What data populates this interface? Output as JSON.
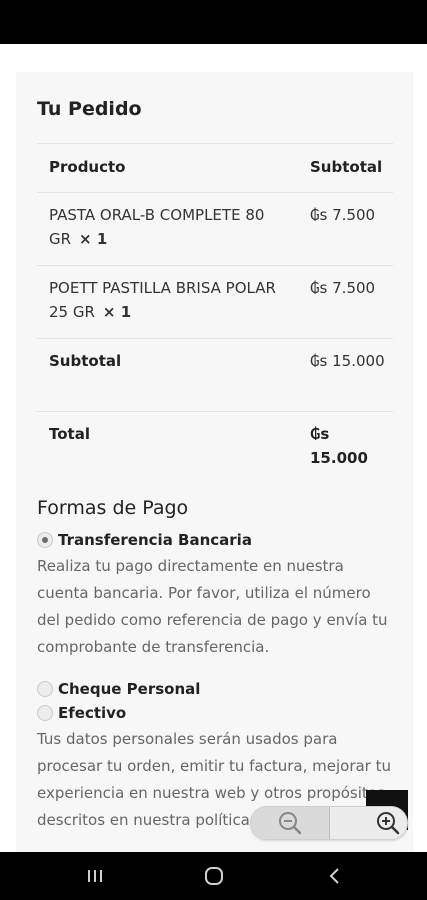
{
  "order": {
    "title": "Tu Pedido",
    "headers": {
      "product": "Producto",
      "subtotal": "Subtotal"
    },
    "items": [
      {
        "name": "PASTA ORAL-B COMPLETE 80 GR",
        "qty": "× 1",
        "price": "₲s 7.500"
      },
      {
        "name": "POETT PASTILLA BRISA POLAR 25 GR",
        "qty": "× 1",
        "price": "₲s 7.500"
      }
    ],
    "subtotal_label": "Subtotal",
    "subtotal_value": "₲s 15.000",
    "total_label": "Total",
    "total_value": "₲s 15.000"
  },
  "payment": {
    "title": "Formas de Pago",
    "options": [
      {
        "label": "Transferencia Bancaria",
        "selected": true
      },
      {
        "label": "Cheque Personal",
        "selected": false
      },
      {
        "label": "Efectivo",
        "selected": false
      }
    ],
    "bank_description": "Realiza tu pago directamente en nuestra cuenta bancaria. Por favor, utiliza el número del pedido como referencia de pago y envía tu comprobante de transferencia.",
    "privacy_text": "Tus datos personales serán usados para procesar tu orden, emitir tu factura, mejorar tu experiencia en nuestra web y otros propósitos descritos en nuestra política de privacidad."
  },
  "icons": {
    "zoom_out": "zoom-out-icon",
    "zoom_in": "zoom-in-icon",
    "scroll_top": "chevron-up-icon",
    "nav_recent": "recent-apps-icon",
    "nav_home": "home-icon",
    "nav_back": "back-icon"
  }
}
